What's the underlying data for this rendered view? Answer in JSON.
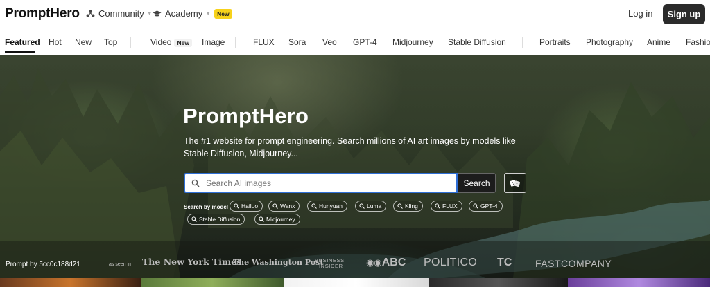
{
  "header": {
    "logo": "PromptHero",
    "community_label": "Community",
    "academy_label": "Academy",
    "academy_badge": "New",
    "login_label": "Log in",
    "signup_label": "Sign up"
  },
  "tabs": {
    "featured": "Featured",
    "hot": "Hot",
    "new": "New",
    "top": "Top",
    "video": "Video",
    "video_badge": "New",
    "image": "Image",
    "flux": "FLUX",
    "sora": "Sora",
    "veo": "Veo",
    "gpt4": "GPT-4",
    "midjourney": "Midjourney",
    "stable_diffusion": "Stable Diffusion",
    "portraits": "Portraits",
    "photography": "Photography",
    "anime": "Anime",
    "fashion": "Fashio"
  },
  "hero": {
    "title": "PromptHero",
    "subtitle": "The #1 website for prompt engineering. Search millions of AI art images by models like Stable Diffusion, Midjourney...",
    "search_placeholder": "Search AI images",
    "search_button": "Search",
    "models_label": "Search by model",
    "models": [
      "Hailuo",
      "Wanx",
      "Hunyuan",
      "Luma",
      "Kling",
      "FLUX",
      "GPT-4",
      "Stable Diffusion",
      "Midjourney"
    ],
    "prompt_by": "Prompt by 5cc0c188d21",
    "seen_in": "as seen in",
    "press": {
      "nyt": "The New York Times",
      "wapo": "The Washington Post",
      "bi_line1": "BUSINESS",
      "bi_line2": "INSIDER",
      "abc": "ABC",
      "politico": "POLITICO",
      "tc": "TC",
      "fastcompany": "FASTCOMPANY"
    }
  },
  "colors": {
    "accent": "#2f6fd6",
    "badge_yellow": "#f7d21b",
    "dark_button": "#2b2b2b"
  }
}
